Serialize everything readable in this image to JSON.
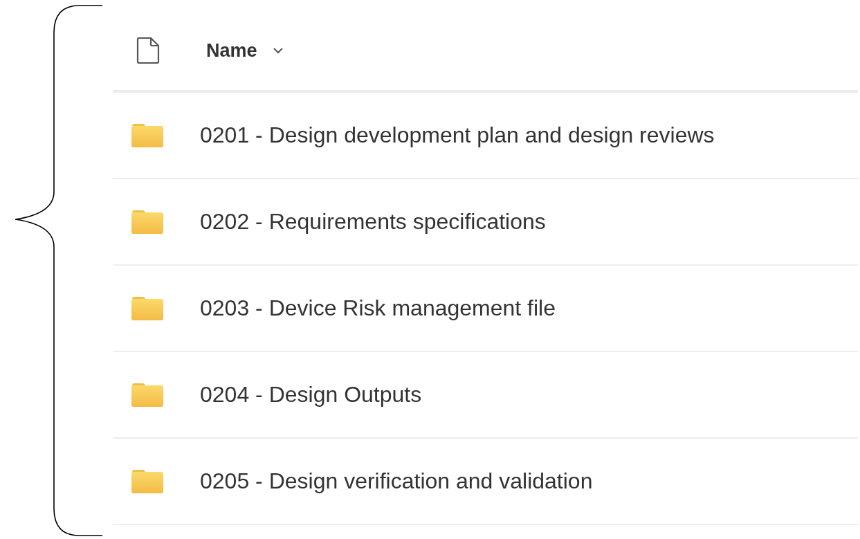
{
  "header": {
    "column_label": "Name"
  },
  "rows": [
    {
      "name": "0201 - Design development plan and design reviews"
    },
    {
      "name": "0202 - Requirements specifications"
    },
    {
      "name": "0203 - Device Risk management file"
    },
    {
      "name": "0204 - Design Outputs"
    },
    {
      "name": "0205 - Design verification and validation"
    }
  ]
}
